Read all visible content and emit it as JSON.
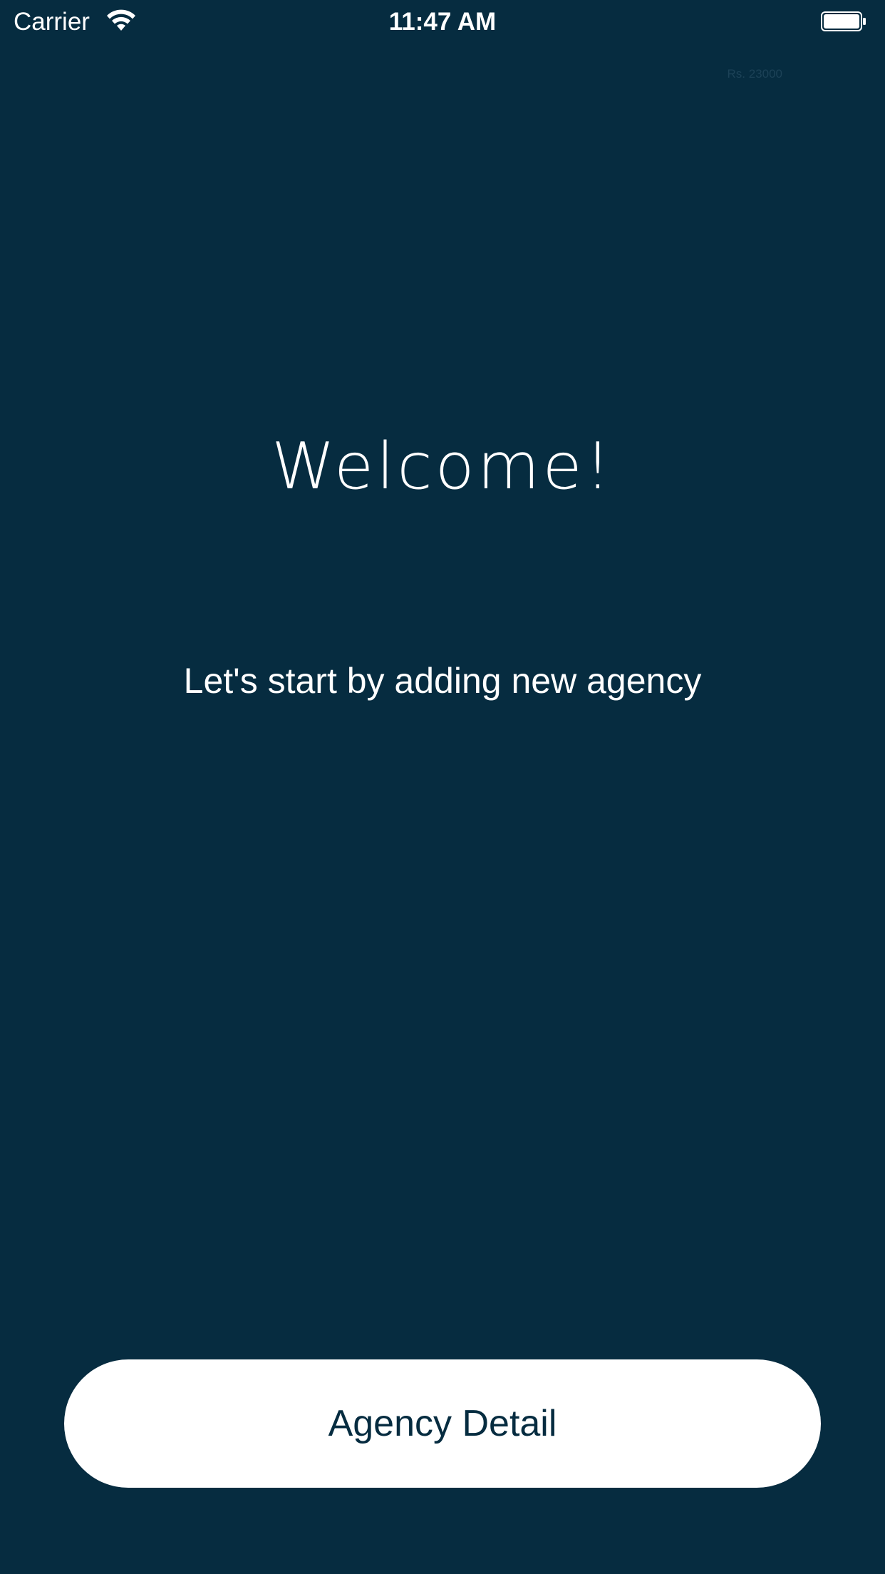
{
  "status_bar": {
    "carrier": "Carrier",
    "time": "11:47 AM",
    "wifi_icon": "wifi-icon",
    "battery_icon": "battery-icon"
  },
  "header": {
    "amount": "Rs. 23000"
  },
  "main": {
    "title": "Welcome!",
    "subtitle": "Let's start by adding new agency"
  },
  "actions": {
    "agency_button_label": "Agency Detail"
  },
  "colors": {
    "background": "#062c40",
    "text": "#ffffff",
    "button_background": "#ffffff",
    "button_text": "#062c40"
  }
}
